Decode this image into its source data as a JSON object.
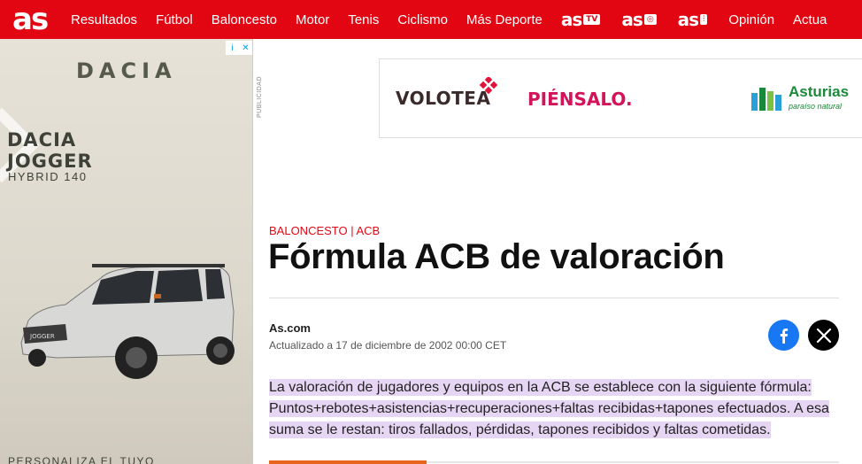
{
  "nav": {
    "logo": "as",
    "items": [
      "Resultados",
      "Fútbol",
      "Baloncesto",
      "Motor",
      "Tenis",
      "Ciclismo",
      "Más Deporte"
    ],
    "brands": [
      {
        "text": "as",
        "suffix": "TV"
      },
      {
        "text": "as",
        "suffix": "◎"
      },
      {
        "text": "as",
        "suffix": "⫶"
      }
    ],
    "trailing": [
      "Opinión",
      "Actua"
    ],
    "bg_color": "#e20613"
  },
  "left_ad": {
    "brand": "DACIA",
    "model_line1": "DACIA",
    "model_line2": "JOGGER",
    "model_sub": "HYBRID 140",
    "car_badge": "JOGGER",
    "footer": "PERSONALIZA EL TUYO",
    "adchoice_i": "i",
    "adchoice_x": "✕"
  },
  "publicidad_label": "PUBLICIDAD",
  "banner": {
    "volotea": "VOLOTEA",
    "piensalo": "PIÉNSALO.",
    "asturias": "Asturias",
    "asturias_sub": "paraíso natural"
  },
  "article": {
    "kicker": "BALONCESTO | ACB",
    "headline": "Fórmula ACB de valoración",
    "author": "As.com",
    "updated": "Actualizado a 17 de diciembre de 2002 00:00 CET",
    "lead": "La valoración de jugadores y equipos en la ACB se establece con la siguiente fórmula: Puntos+rebotes+asistencias+recuperaciones+faltas recibidas+tapones efectuados. A esa suma se le restan: tiros fallados, pérdidas, tapones recibidos y faltas cometidas.",
    "highlight_color": "#e7d6f3"
  },
  "share": {
    "facebook_color": "#1877f2",
    "x_color": "#000000"
  }
}
